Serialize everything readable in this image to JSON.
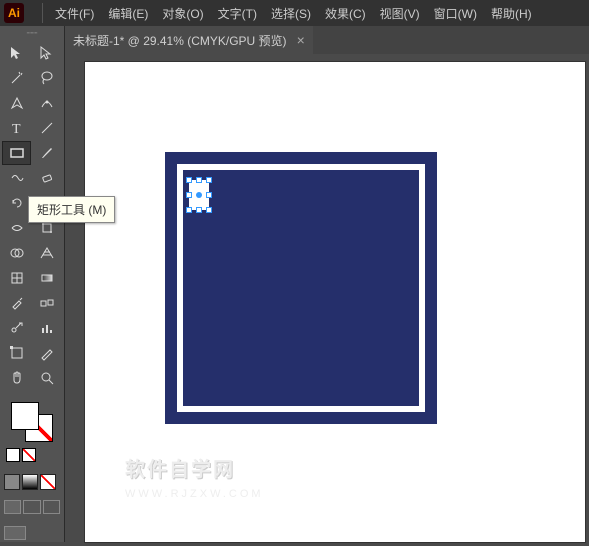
{
  "app": {
    "logo_text": "Ai"
  },
  "menu": {
    "items": [
      {
        "label": "文件(F)"
      },
      {
        "label": "编辑(E)"
      },
      {
        "label": "对象(O)"
      },
      {
        "label": "文字(T)"
      },
      {
        "label": "选择(S)"
      },
      {
        "label": "效果(C)"
      },
      {
        "label": "视图(V)"
      },
      {
        "label": "窗口(W)"
      },
      {
        "label": "帮助(H)"
      }
    ]
  },
  "document": {
    "tab_title": "未标题-1* @ 29.41% (CMYK/GPU 预览)",
    "close_glyph": "×"
  },
  "tooltip": {
    "rectangle_tool": "矩形工具 (M)"
  },
  "watermark": {
    "main": "软件自学网",
    "sub": "WWW.RJZXW.COM"
  },
  "colors": {
    "artwork_fill": "#252f6b",
    "artwork_stroke": "#ffffff",
    "accent_orange": "#ff9a00"
  },
  "tools": [
    "selection",
    "direct-selection",
    "magic-wand",
    "lasso",
    "pen",
    "curvature",
    "type",
    "line-segment",
    "rectangle",
    "paintbrush",
    "shaper",
    "eraser",
    "rotate",
    "scale",
    "width",
    "free-transform",
    "shape-builder",
    "perspective-grid",
    "mesh",
    "gradient",
    "eyedropper",
    "blend",
    "symbol-sprayer",
    "column-graph",
    "artboard",
    "slice",
    "hand",
    "zoom"
  ]
}
